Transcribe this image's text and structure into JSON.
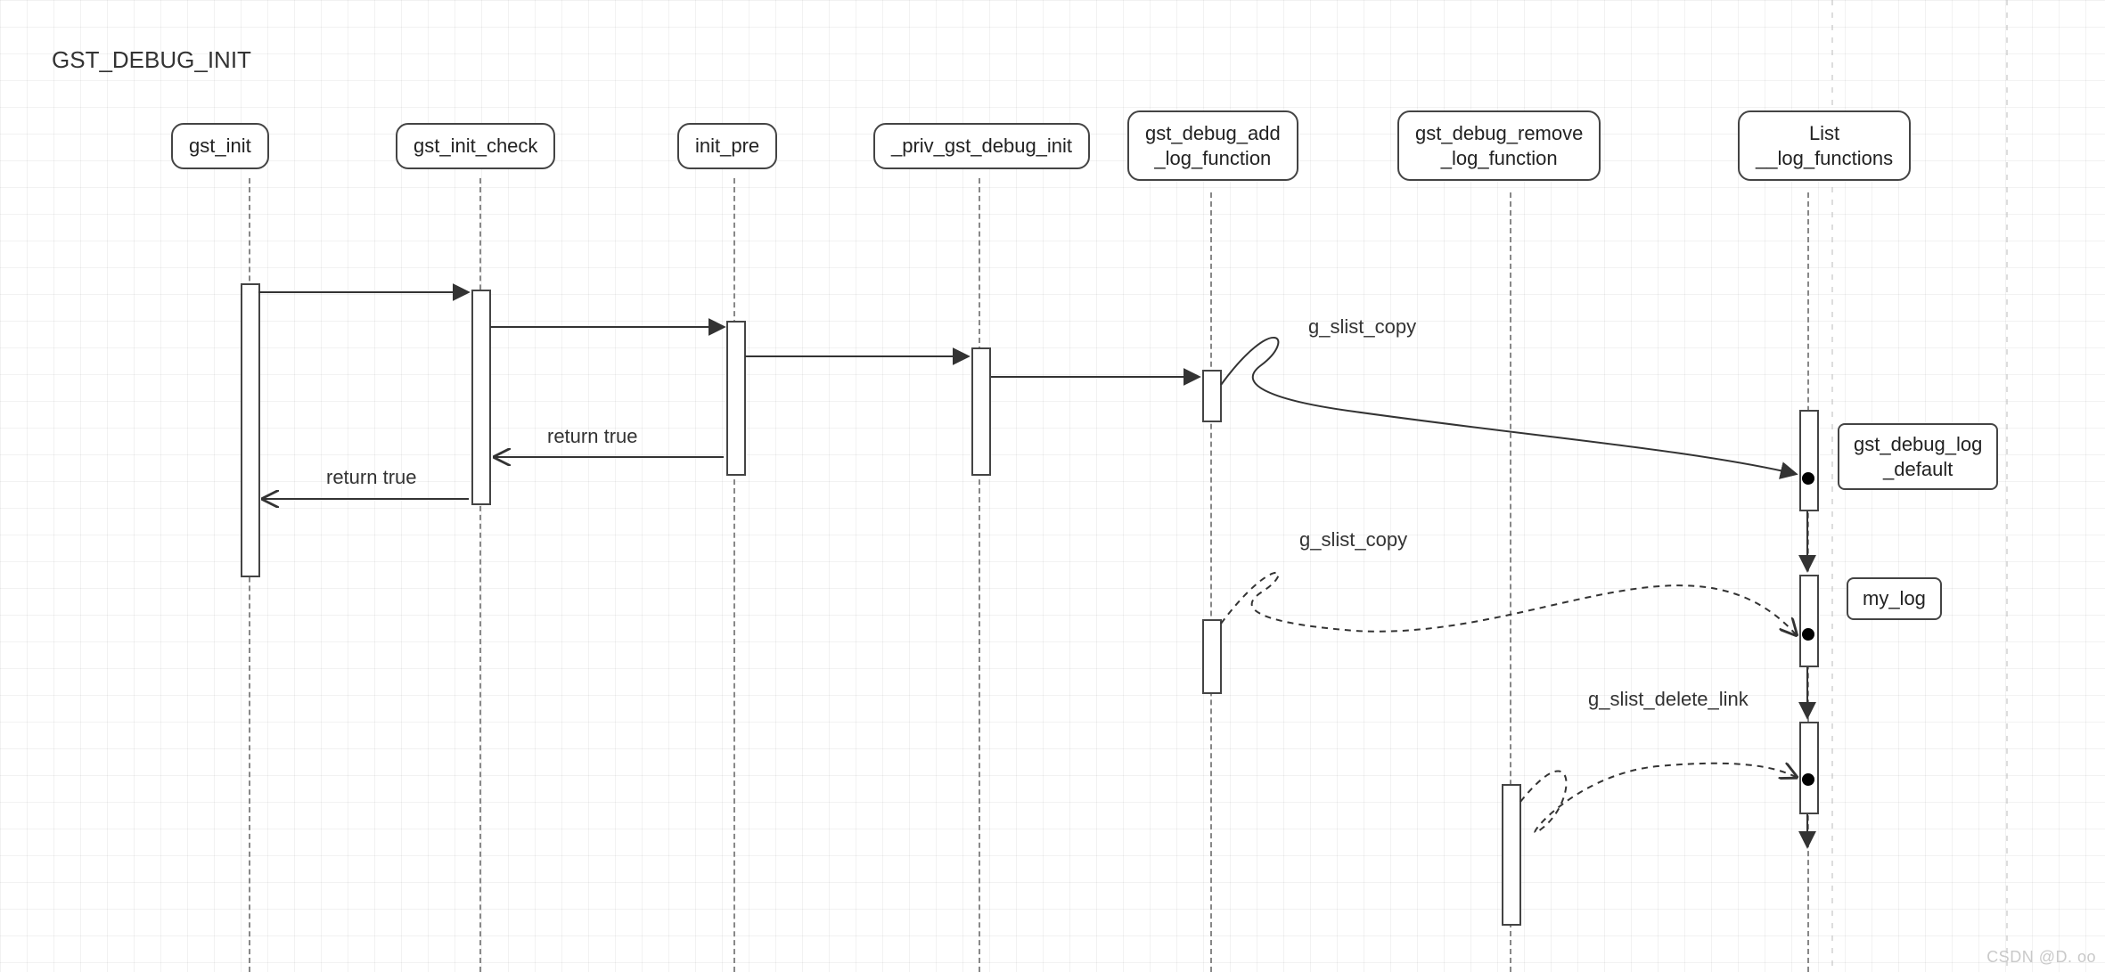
{
  "title": "GST_DEBUG_INIT",
  "watermark": "CSDN @D. oo",
  "participants": {
    "gst_init": "gst_init",
    "gst_init_check": "gst_init_check",
    "init_pre": "init_pre",
    "priv_gst_debug_init": "_priv_gst_debug_init",
    "gst_debug_add_log_function": "gst_debug_add\n_log_function",
    "gst_debug_remove_log_function": "gst_debug_remove\n_log_function",
    "list_log_functions": "List\n__log_functions"
  },
  "notes": {
    "gst_debug_log_default": "gst_debug_log\n_default",
    "my_log": "my_log"
  },
  "messages": {
    "return_true_1": "return true",
    "return_true_2": "return true",
    "g_slist_copy_1": "g_slist_copy",
    "g_slist_copy_2": "g_slist_copy",
    "g_slist_delete_link": "g_slist_delete_link"
  }
}
